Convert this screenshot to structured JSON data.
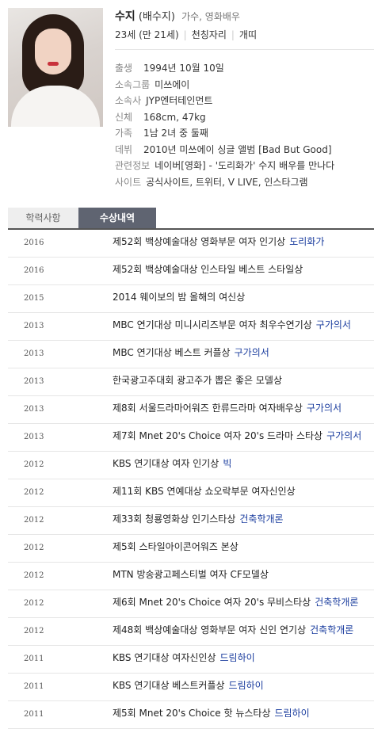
{
  "profile": {
    "name": "수지",
    "real_name": "(배수지)",
    "job": "가수, 영화배우",
    "age": "23세 (만 21세)",
    "zodiac_sign": "천칭자리",
    "chinese_zodiac": "개띠",
    "info": [
      {
        "key": "출생",
        "value": "1994년 10월 10일",
        "type": "text"
      },
      {
        "key": "소속그룹",
        "value": "미쓰에이",
        "type": "link"
      },
      {
        "key": "소속사",
        "value": "JYP엔터테인먼트",
        "type": "link"
      },
      {
        "key": "신체",
        "value": "168cm, 47kg",
        "type": "text"
      },
      {
        "key": "가족",
        "value": "1남 2녀 중 둘째",
        "type": "text"
      },
      {
        "key": "데뷔",
        "value": "2010년 미쓰에이 싱글 앨범 [Bad But Good]",
        "type": "text"
      },
      {
        "key": "관련정보",
        "value": "네이버[영화] - '도리화가' 수지 배우를 만나다",
        "type": "link"
      },
      {
        "key": "사이트",
        "value": "공식사이트, 트위터, V LIVE, 인스타그램",
        "type": "link"
      }
    ]
  },
  "tabs": {
    "education": "학력사항",
    "awards": "수상내역"
  },
  "awards": [
    {
      "year": "2016",
      "title": "제52회 백상예술대상 영화부문 여자 인기상",
      "work": "도리화가"
    },
    {
      "year": "2016",
      "title": "제52회 백상예술대상 인스타일 베스트 스타일상",
      "work": ""
    },
    {
      "year": "2015",
      "title": "2014 웨이보의 밤 올해의 여신상",
      "work": ""
    },
    {
      "year": "2013",
      "title": "MBC 연기대상 미니시리즈부문 여자 최우수연기상",
      "work": "구가의서"
    },
    {
      "year": "2013",
      "title": "MBC 연기대상 베스트 커플상",
      "work": "구가의서"
    },
    {
      "year": "2013",
      "title": "한국광고주대회 광고주가 뽑은 좋은 모델상",
      "work": ""
    },
    {
      "year": "2013",
      "title": "제8회 서울드라마어워즈 한류드라마 여자배우상",
      "work": "구가의서"
    },
    {
      "year": "2013",
      "title": "제7회 Mnet 20's Choice 여자 20's 드라마 스타상",
      "work": "구가의서"
    },
    {
      "year": "2012",
      "title": "KBS 연기대상 여자 인기상",
      "work": "빅"
    },
    {
      "year": "2012",
      "title": "제11회 KBS 연예대상 쇼오락부문 여자신인상",
      "work": ""
    },
    {
      "year": "2012",
      "title": "제33회 청룡영화상 인기스타상",
      "work": "건축학개론"
    },
    {
      "year": "2012",
      "title": "제5회 스타일아이콘어워즈 본상",
      "work": ""
    },
    {
      "year": "2012",
      "title": "MTN 방송광고페스티벌 여자 CF모델상",
      "work": ""
    },
    {
      "year": "2012",
      "title": "제6회 Mnet 20's Choice 여자 20's 무비스타상",
      "work": "건축학개론"
    },
    {
      "year": "2012",
      "title": "제48회 백상예술대상 영화부문 여자 신인 연기상",
      "work": "건축학개론"
    },
    {
      "year": "2011",
      "title": "KBS 연기대상 여자신인상",
      "work": "드림하이"
    },
    {
      "year": "2011",
      "title": "KBS 연기대상 베스트커플상",
      "work": "드림하이"
    },
    {
      "year": "2011",
      "title": "제5회 Mnet 20's Choice 핫 뉴스타상",
      "work": "드림하이"
    }
  ]
}
